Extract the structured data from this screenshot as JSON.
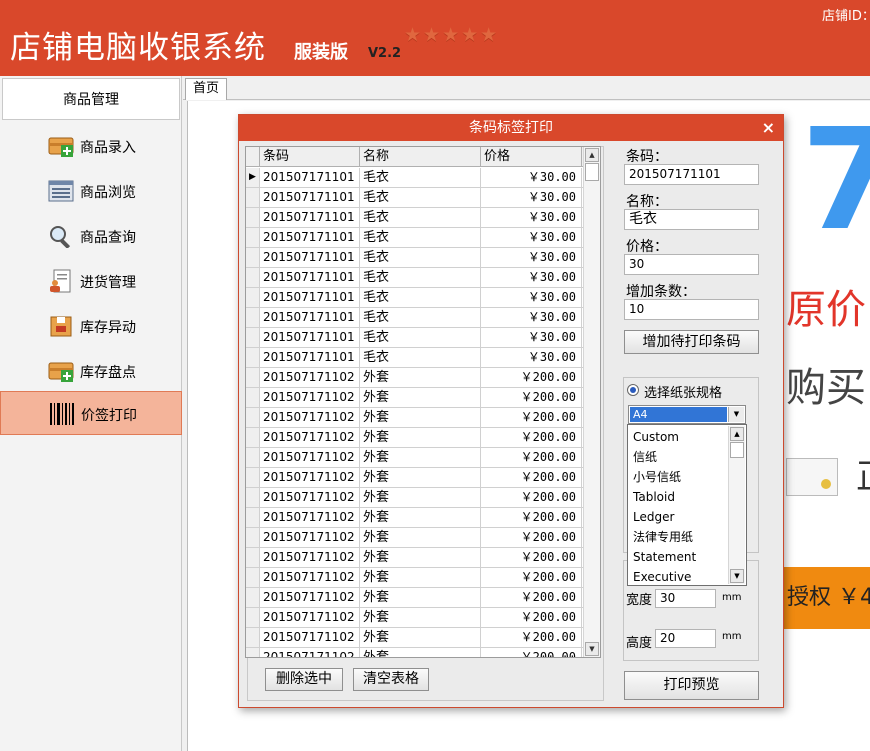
{
  "header": {
    "title": "店铺电脑收银系统",
    "edition": "服装版",
    "version": "V2.2",
    "stars": "★★★★★",
    "store_id_label": "店铺ID："
  },
  "sidebar": {
    "section_title": "商品管理",
    "items": [
      {
        "label": "商品录入",
        "icon": "box-add-icon"
      },
      {
        "label": "商品浏览",
        "icon": "list-view-icon"
      },
      {
        "label": "商品查询",
        "icon": "magnifier-icon"
      },
      {
        "label": "进货管理",
        "icon": "person-document-icon"
      },
      {
        "label": "库存异动",
        "icon": "box-move-icon"
      },
      {
        "label": "库存盘点",
        "icon": "box-check-icon"
      },
      {
        "label": "价签打印",
        "icon": "barcode-icon",
        "active": true
      }
    ]
  },
  "tabs": [
    {
      "label": "首页"
    }
  ],
  "promo": {
    "big_number": "7",
    "line1": "原价",
    "line2": "购买",
    "line3": "正",
    "bar_text": "授权 ￥4"
  },
  "dialog": {
    "title": "条码标签打印",
    "close": "×",
    "grid": {
      "columns": [
        "条码",
        "名称",
        "价格"
      ],
      "current_row_marker": "▶",
      "rows": [
        {
          "code": "201507171101",
          "name": "毛衣",
          "price": "￥30.00"
        },
        {
          "code": "201507171101",
          "name": "毛衣",
          "price": "￥30.00"
        },
        {
          "code": "201507171101",
          "name": "毛衣",
          "price": "￥30.00"
        },
        {
          "code": "201507171101",
          "name": "毛衣",
          "price": "￥30.00"
        },
        {
          "code": "201507171101",
          "name": "毛衣",
          "price": "￥30.00"
        },
        {
          "code": "201507171101",
          "name": "毛衣",
          "price": "￥30.00"
        },
        {
          "code": "201507171101",
          "name": "毛衣",
          "price": "￥30.00"
        },
        {
          "code": "201507171101",
          "name": "毛衣",
          "price": "￥30.00"
        },
        {
          "code": "201507171101",
          "name": "毛衣",
          "price": "￥30.00"
        },
        {
          "code": "201507171101",
          "name": "毛衣",
          "price": "￥30.00"
        },
        {
          "code": "201507171102",
          "name": "外套",
          "price": "￥200.00"
        },
        {
          "code": "201507171102",
          "name": "外套",
          "price": "￥200.00"
        },
        {
          "code": "201507171102",
          "name": "外套",
          "price": "￥200.00"
        },
        {
          "code": "201507171102",
          "name": "外套",
          "price": "￥200.00"
        },
        {
          "code": "201507171102",
          "name": "外套",
          "price": "￥200.00"
        },
        {
          "code": "201507171102",
          "name": "外套",
          "price": "￥200.00"
        },
        {
          "code": "201507171102",
          "name": "外套",
          "price": "￥200.00"
        },
        {
          "code": "201507171102",
          "name": "外套",
          "price": "￥200.00"
        },
        {
          "code": "201507171102",
          "name": "外套",
          "price": "￥200.00"
        },
        {
          "code": "201507171102",
          "name": "外套",
          "price": "￥200.00"
        },
        {
          "code": "201507171102",
          "name": "外套",
          "price": "￥200.00"
        },
        {
          "code": "201507171102",
          "name": "外套",
          "price": "￥200.00"
        },
        {
          "code": "201507171102",
          "name": "外套",
          "price": "￥200.00"
        },
        {
          "code": "201507171102",
          "name": "外套",
          "price": "￥200.00"
        },
        {
          "code": "201507171102",
          "name": "外套",
          "price": "￥200.00"
        }
      ]
    },
    "delete_button": "删除选中",
    "clear_button": "清空表格",
    "form": {
      "code_label": "条码：",
      "code_value": "201507171101",
      "name_label": "名称：",
      "name_value": "毛衣",
      "price_label": "价格：",
      "price_value": "30",
      "count_label": "增加条数：",
      "count_value": "10",
      "add_button": "增加待打印条码"
    },
    "paper": {
      "radio_label": "选择纸张规格",
      "selected": "A4",
      "options": [
        "Custom",
        "信纸",
        "小号信纸",
        "Tabloid",
        "Ledger",
        "法律专用纸",
        "Statement",
        "Executive"
      ]
    },
    "custom_size": {
      "width_label": "宽度",
      "width_value": "30",
      "height_label": "高度",
      "height_value": "20",
      "unit": "mm"
    },
    "preview_button": "打印预览"
  }
}
